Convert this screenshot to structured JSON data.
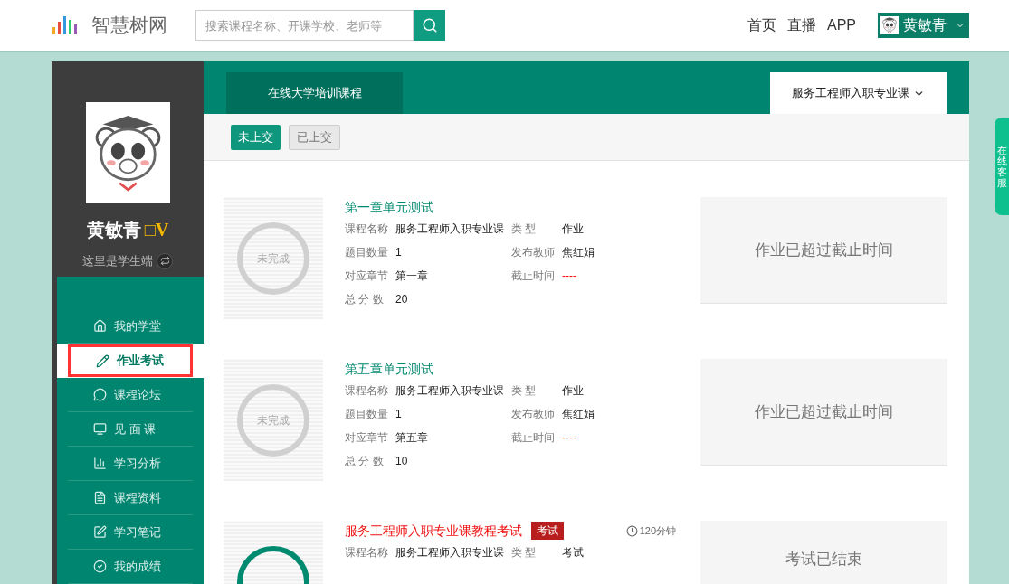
{
  "header": {
    "logo": "智慧树网",
    "search": {
      "placeholder": "搜索课程名称、开课学校、老师等"
    },
    "nav": [
      "首页",
      "直播",
      "APP"
    ],
    "user": {
      "name": "黄敏青"
    }
  },
  "sidebar": {
    "profile": {
      "name": "黄敏青",
      "badge": "□V",
      "role_text": "这里是学生端"
    },
    "items": [
      {
        "label": "我的学堂",
        "selected": false
      },
      {
        "label": "作业考试",
        "selected": true
      },
      {
        "label": "课程论坛",
        "selected": false
      },
      {
        "label": "见 面 课",
        "selected": false
      },
      {
        "label": "学习分析",
        "selected": false
      },
      {
        "label": "课程资料",
        "selected": false
      },
      {
        "label": "学习笔记",
        "selected": false
      },
      {
        "label": "我的成绩",
        "selected": false
      }
    ]
  },
  "course_tab": {
    "label": "在线大学培训课程"
  },
  "course_select": {
    "label": "服务工程师入职专业课"
  },
  "filters": [
    {
      "label": "未上交",
      "selected": true
    },
    {
      "label": "已上交",
      "selected": false
    }
  ],
  "items": [
    {
      "kind": "homework",
      "title": "第一章单元测试",
      "stamp": "未完成",
      "left_fields": [
        {
          "label": "课程名称",
          "value": "服务工程师入职专业课"
        },
        {
          "label": "题目数量",
          "value": "1"
        },
        {
          "label": "对应章节",
          "value": "第一章"
        },
        {
          "label": "总 分 数",
          "value": "20"
        }
      ],
      "right_fields": [
        {
          "label": "类 型",
          "value": "作业"
        },
        {
          "label": "发布教师",
          "value": "焦红娟"
        }
      ],
      "deadline": {
        "label": "截止时间",
        "value": "----"
      },
      "status": "作业已超过截止时间"
    },
    {
      "kind": "homework",
      "title": "第五章单元测试",
      "stamp": "未完成",
      "left_fields": [
        {
          "label": "课程名称",
          "value": "服务工程师入职专业课"
        },
        {
          "label": "题目数量",
          "value": "1"
        },
        {
          "label": "对应章节",
          "value": "第五章"
        },
        {
          "label": "总 分 数",
          "value": "10"
        }
      ],
      "right_fields": [
        {
          "label": "类 型",
          "value": "作业"
        },
        {
          "label": "发布教师",
          "value": "焦红娟"
        }
      ],
      "deadline": {
        "label": "截止时间",
        "value": "----"
      },
      "status": "作业已超过截止时间"
    },
    {
      "kind": "exam",
      "title": "服务工程师入职专业课教程考试",
      "badge": "考试",
      "duration": "120分钟",
      "left_fields": [
        {
          "label": "课程名称",
          "value": "服务工程师入职专业课"
        }
      ],
      "right_fields": [
        {
          "label": "类 型",
          "value": "考试"
        }
      ],
      "status": "考试已结束"
    }
  ],
  "side_tab": {
    "label": "在线客服"
  }
}
